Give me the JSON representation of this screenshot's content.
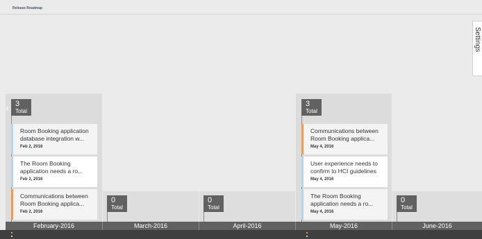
{
  "app": {
    "title": "Release Roadmap",
    "settings_label": "Settings"
  },
  "colors": {
    "badge": "#616161",
    "card_blue": "#b8d4ec",
    "card_orange": "#f39a49",
    "axis": "#616161"
  },
  "columns": {
    "feb": {
      "count": "3",
      "count_label": "Total",
      "cards": [
        {
          "title": "Room Booking application database integration w...",
          "date": "Feb 2, 2016",
          "accent": "blue"
        },
        {
          "title": "The Room Booking application needs a ro...",
          "date": "Feb 2, 2016",
          "accent": "blue"
        },
        {
          "title": "Communications between Room Booking applica...",
          "date": "Feb 2, 2016",
          "accent": "orange"
        }
      ]
    },
    "mar": {
      "count": "0",
      "count_label": "Total"
    },
    "apr": {
      "count": "0",
      "count_label": "Total"
    },
    "may": {
      "count": "3",
      "count_label": "Total",
      "cards": [
        {
          "title": "Communications between Room Booking applica...",
          "date": "May 4, 2016",
          "accent": "orange"
        },
        {
          "title": "User experience needs to confirm to HCI guidelines",
          "date": "May 4, 2016",
          "accent": "blue"
        },
        {
          "title": "The Room Booking application needs a ro...",
          "date": "May 4, 2016",
          "accent": "blue"
        }
      ]
    },
    "jun": {
      "count": "0",
      "count_label": "Total"
    }
  },
  "months": [
    "February-2016",
    "March-2016",
    "April-2016",
    "May-2016",
    "June-2016"
  ],
  "icons": {
    "back": "chevron-left-icon"
  }
}
